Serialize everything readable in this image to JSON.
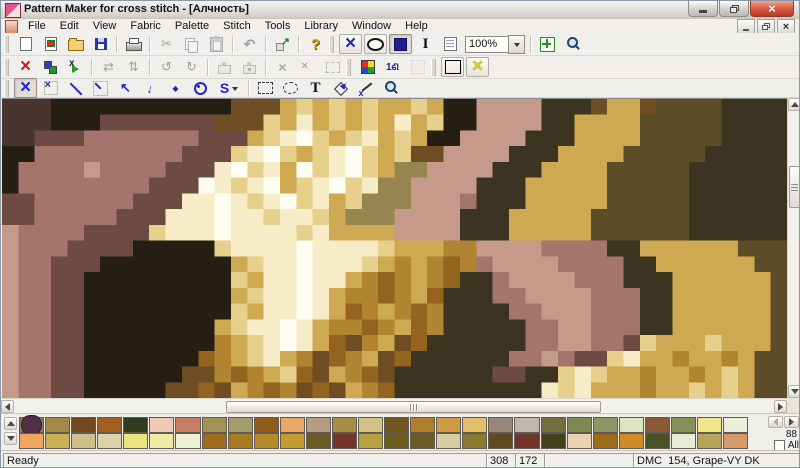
{
  "window": {
    "title": "Pattern Maker for cross stitch - [Алчность]"
  },
  "menu": {
    "items": [
      "File",
      "Edit",
      "View",
      "Fabric",
      "Palette",
      "Stitch",
      "Tools",
      "Library",
      "Window",
      "Help"
    ]
  },
  "toolbars": {
    "main": {
      "zoom_value": "100%",
      "buttons": [
        {
          "name": "new",
          "icon": "new-page-icon",
          "enabled": true
        },
        {
          "name": "new-from-image",
          "icon": "page-image-icon",
          "enabled": true
        },
        {
          "name": "open",
          "icon": "open-folder-icon",
          "enabled": true
        },
        {
          "name": "save",
          "icon": "save-floppy-icon",
          "enabled": true
        },
        {
          "type": "sep"
        },
        {
          "name": "print",
          "icon": "printer-icon",
          "enabled": true
        },
        {
          "type": "sep"
        },
        {
          "name": "cut",
          "icon": "scissors-icon",
          "enabled": false
        },
        {
          "name": "copy",
          "icon": "copy-icon",
          "enabled": false
        },
        {
          "name": "paste",
          "icon": "paste-icon",
          "enabled": false
        },
        {
          "type": "sep"
        },
        {
          "name": "undo",
          "icon": "undo-arrow-icon",
          "enabled": false
        },
        {
          "type": "sep"
        },
        {
          "name": "export",
          "icon": "export-icon",
          "enabled": true
        },
        {
          "type": "sep"
        },
        {
          "name": "help",
          "icon": "help-question-icon",
          "enabled": true
        },
        {
          "type": "gap"
        },
        {
          "name": "view-full-stitches",
          "icon": "blue-cross-icon",
          "enabled": true,
          "framed": true
        },
        {
          "name": "view-symbols",
          "icon": "oval-icon",
          "enabled": true,
          "framed": true
        },
        {
          "name": "view-solid",
          "icon": "solid-square-icon",
          "enabled": true,
          "framed": true,
          "active": true
        },
        {
          "name": "view-information",
          "icon": "info-icon",
          "enabled": true
        },
        {
          "name": "view-notes",
          "icon": "notes-grid-icon",
          "enabled": true
        },
        {
          "type": "zoom-combo"
        },
        {
          "type": "sep"
        },
        {
          "name": "fit-to-window",
          "icon": "fit-arrows-icon",
          "enabled": true
        },
        {
          "name": "zoom-previous",
          "icon": "magnifier-rotate-icon",
          "enabled": true
        }
      ]
    },
    "edit": {
      "buttons": [
        {
          "name": "delete-stitches",
          "icon": "red-x-icon",
          "enabled": true
        },
        {
          "name": "swap-colors",
          "icon": "swap-colors-icon",
          "enabled": true
        },
        {
          "name": "replace-color",
          "icon": "replace-color-icon",
          "enabled": true
        },
        {
          "type": "sep"
        },
        {
          "name": "flip-horizontal",
          "icon": "flip-horizontal-icon",
          "enabled": false
        },
        {
          "name": "flip-vertical",
          "icon": "flip-vertical-icon",
          "enabled": false
        },
        {
          "type": "sep"
        },
        {
          "name": "rotate-left",
          "icon": "rotate-left-icon",
          "enabled": false
        },
        {
          "name": "rotate-right",
          "icon": "rotate-right-icon",
          "enabled": false
        },
        {
          "type": "sep"
        },
        {
          "name": "stamp",
          "icon": "stamp-icon",
          "enabled": false
        },
        {
          "name": "motif",
          "icon": "motif-icon",
          "enabled": false
        },
        {
          "type": "sep"
        },
        {
          "name": "cross-a",
          "icon": "gray-cross-icon",
          "enabled": false
        },
        {
          "name": "cross-b",
          "icon": "gray-small-cross-icon",
          "enabled": false
        },
        {
          "name": "selection-box",
          "icon": "marquee-icon",
          "enabled": false
        },
        {
          "type": "gap"
        },
        {
          "name": "palette-colors",
          "icon": "palette-quad-icon",
          "enabled": true
        },
        {
          "name": "number-symbols",
          "icon": "numbers-123-icon",
          "enabled": true
        },
        {
          "name": "highlight",
          "icon": "sparkle-icon",
          "enabled": false
        },
        {
          "type": "gap"
        },
        {
          "name": "show-grid",
          "icon": "grid-icon",
          "enabled": true,
          "framed": true
        },
        {
          "name": "show-stitches",
          "icon": "yellow-cross-icon",
          "enabled": true,
          "framed": true
        }
      ]
    },
    "stitch": {
      "buttons": [
        {
          "name": "full-cross-stitch",
          "icon": "full-cross-icon",
          "enabled": true,
          "framed": true,
          "active": true
        },
        {
          "name": "petite-stitch",
          "icon": "petite-cross-icon",
          "enabled": true
        },
        {
          "name": "half-stitch",
          "icon": "half-stitch-icon",
          "enabled": true
        },
        {
          "name": "quarter-stitch",
          "icon": "quarter-stitch-icon",
          "enabled": true
        },
        {
          "name": "back-stitch",
          "icon": "back-stitch-icon",
          "enabled": true
        },
        {
          "name": "straight-stitch",
          "icon": "straight-stitch-icon",
          "enabled": true
        },
        {
          "name": "french-knot",
          "icon": "french-knot-icon",
          "enabled": true
        },
        {
          "name": "bead",
          "icon": "bead-icon",
          "enabled": true
        },
        {
          "name": "special-stitch",
          "icon": "special-s-icon",
          "enabled": true,
          "dropdown": true
        },
        {
          "type": "sep"
        },
        {
          "name": "select-rectangle",
          "icon": "select-rect-icon",
          "enabled": true
        },
        {
          "name": "select-freehand",
          "icon": "select-lasso-icon",
          "enabled": true
        },
        {
          "name": "text-tool",
          "icon": "text-t-icon",
          "enabled": true
        },
        {
          "name": "fill-tool",
          "icon": "fill-bucket-icon",
          "enabled": true
        },
        {
          "name": "color-picker",
          "icon": "dropper-icon",
          "enabled": true
        },
        {
          "name": "zoom-tool",
          "icon": "magnifier-icon",
          "enabled": true
        }
      ]
    }
  },
  "canvas": {
    "pixel_palette": {
      "k": "#241f12",
      "d": "#3b3420",
      "o": "#5c4c28",
      "b": "#6e4d22",
      "B": "#94641f",
      "g": "#b08430",
      "G": "#cfa952",
      "y": "#e7d08b",
      "Y": "#f6edc8",
      "w": "#fffdf2",
      "t": "#97854f",
      "m": "#6d4a42",
      "r": "#a4756a",
      "R": "#c69a8b",
      "M": "#4a3430"
    },
    "pixel_rows": [
      "MMMkkkkkkkkkkkbbbGyGyGyGGyGkkRRRRdddbGGboooodddd",
      "MMMkkkmmmmmmmbbbyGYGyGyGYGykkRRRRddGGGGooooodddd",
      "MMmmmrrrrrrrmmmGyYwyGyYGyGkkRRRRdddGGGGooooodddd",
      "kkrrrrrrrrrmmmyYwyGyYwyGybbRRRRdddGGGGoooooddddd",
      "krrrrRrrrrmmmYwyYGwyYwyGttRRRRdddGGGGooooodddddd",
      "krrrrrrrrmmmwYyYwGyYwyYttRRRRdddGGGGGooooodddddd",
      "mmrrrrrrmmmYYwYyYwyYGytttRRRrdddGGGGGooooodddddd",
      "mmrrrrrmmmYYYwYYyYYyGtttRRRRdddGGGGGoooooodddddd",
      "RrrrrmmmmyYYYwYYYYyYGGGGRRRRdddGGGGGoooooodddddd",
      "RrrrmmmmkkkkkyYYYYwYYYYyGGGggRRRRrrrrddGGGGGGooo",
      "RrrmmmkkkkkkkkGyYYwYYYyGgGgBgrRRRRrrrrddGGGGGGoo",
      "RrrmmkkkkkkkkkyGYYwYYGgBgGgBddrRRRRrrrdddGGGGGGo",
      "RrrmmkkkkkkkkkGyYYwYGggBgGBdddrrRRRRrrrddGGGGGGo",
      "RrrmmkkkkkkkkkyGYYwYGBgGgBgddddrrRRRrrrddGGGGGGo",
      "RrrmmkkkkkkkkGyYYwYGggBgGBgdddddrrRRrrrddGGGGGGo",
      "RrrmmkkkkkkkkgGyYwYGBbgGbBddddddrrRRrrmyGGGyGGGo",
      "RrrmmkkkkkkkBgGyYGgbBgGbBddddddrrRrmmyYGGgGGgGoo",
      "RrrmmkkkkkkbbgBgGyBbGgBbddddddmmddyYyGGgGGgGyGoo",
      "RrrmmkkkkkbbBbGgBgbBbGgBdddddddddYyYGGGgGGyGyGoo"
    ]
  },
  "palette_bar": {
    "count": "88",
    "all_label": "All",
    "selected_index": 0,
    "row1": [
      "#4f3048",
      "#a18a45",
      "#70491f",
      "#a35f22",
      "#31391f",
      "#efc9b2",
      "#c87e62",
      "#a39256",
      "#a49d68",
      "#8f5c1b",
      "#e8a967",
      "#b79c80",
      "#a58e48",
      "#d2c387",
      "#6f571f",
      "#b07f2e",
      "#cf9a44",
      "#e3c06c",
      "#958879",
      "#c4b4ae",
      "#716f40",
      "#7e8852",
      "#8f9663",
      "#dce4c0",
      "#8a5834",
      "#87905b",
      "#f0e68a",
      "#eceddb"
    ],
    "row2": [
      "#f0a55e",
      "#cbaf52",
      "#cfc08b",
      "#ddd2a8",
      "#ece27b",
      "#eeeca3",
      "#eef0d4",
      "#9d6d1d",
      "#a87b22",
      "#b58a2a",
      "#c29b32",
      "#6b5a24",
      "#74352b",
      "#b5a23f",
      "#6e5c1f",
      "#6b5b28",
      "#d6cda2",
      "#8a7a30",
      "#5e4a20",
      "#6e3528",
      "#43421f",
      "#ecd2b0",
      "#a06a1c",
      "#d28a28",
      "#4a5226",
      "#e8ecd4",
      "#b5a45a",
      "#d59a6a"
    ]
  },
  "status_bar": {
    "message": "Ready",
    "x": "308",
    "y": "172",
    "blank": "",
    "color_info": "DMC  154, Grape-VY DK"
  }
}
